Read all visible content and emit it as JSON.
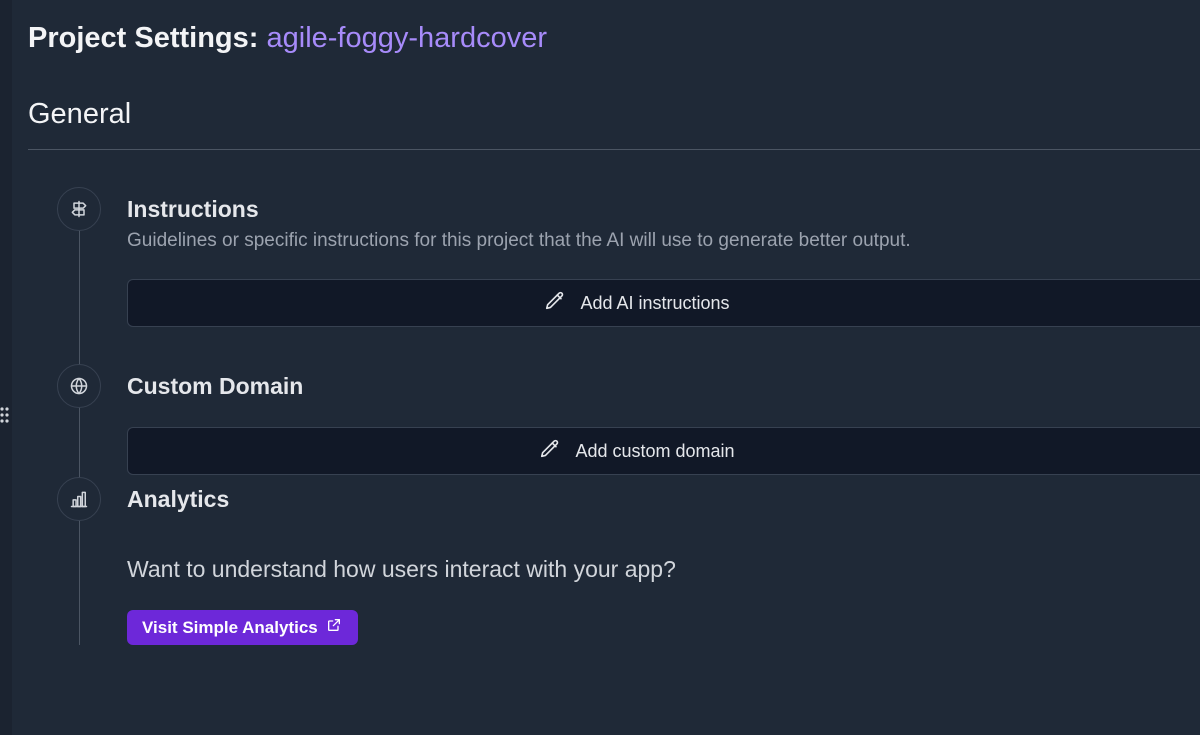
{
  "header": {
    "title_prefix": "Project Settings:",
    "project_name": "agile-foggy-hardcover"
  },
  "section": {
    "title": "General"
  },
  "steps": {
    "instructions": {
      "icon": "signpost-icon",
      "title": "Instructions",
      "description": "Guidelines or specific instructions for this project that the AI will use to generate better output.",
      "button_label": "Add AI instructions",
      "button_icon": "pencil-icon"
    },
    "custom_domain": {
      "icon": "globe-icon",
      "title": "Custom Domain",
      "button_label": "Add custom domain",
      "button_icon": "pencil-icon"
    },
    "analytics": {
      "icon": "bar-chart-icon",
      "title": "Analytics",
      "prompt": "Want to understand how users interact with your app?",
      "button_label": "Visit Simple Analytics",
      "button_icon": "external-link-icon"
    }
  },
  "colors": {
    "background": "#1f2937",
    "accent": "#a78bfa",
    "cta_background": "#6d28d9",
    "button_background": "#111827"
  }
}
